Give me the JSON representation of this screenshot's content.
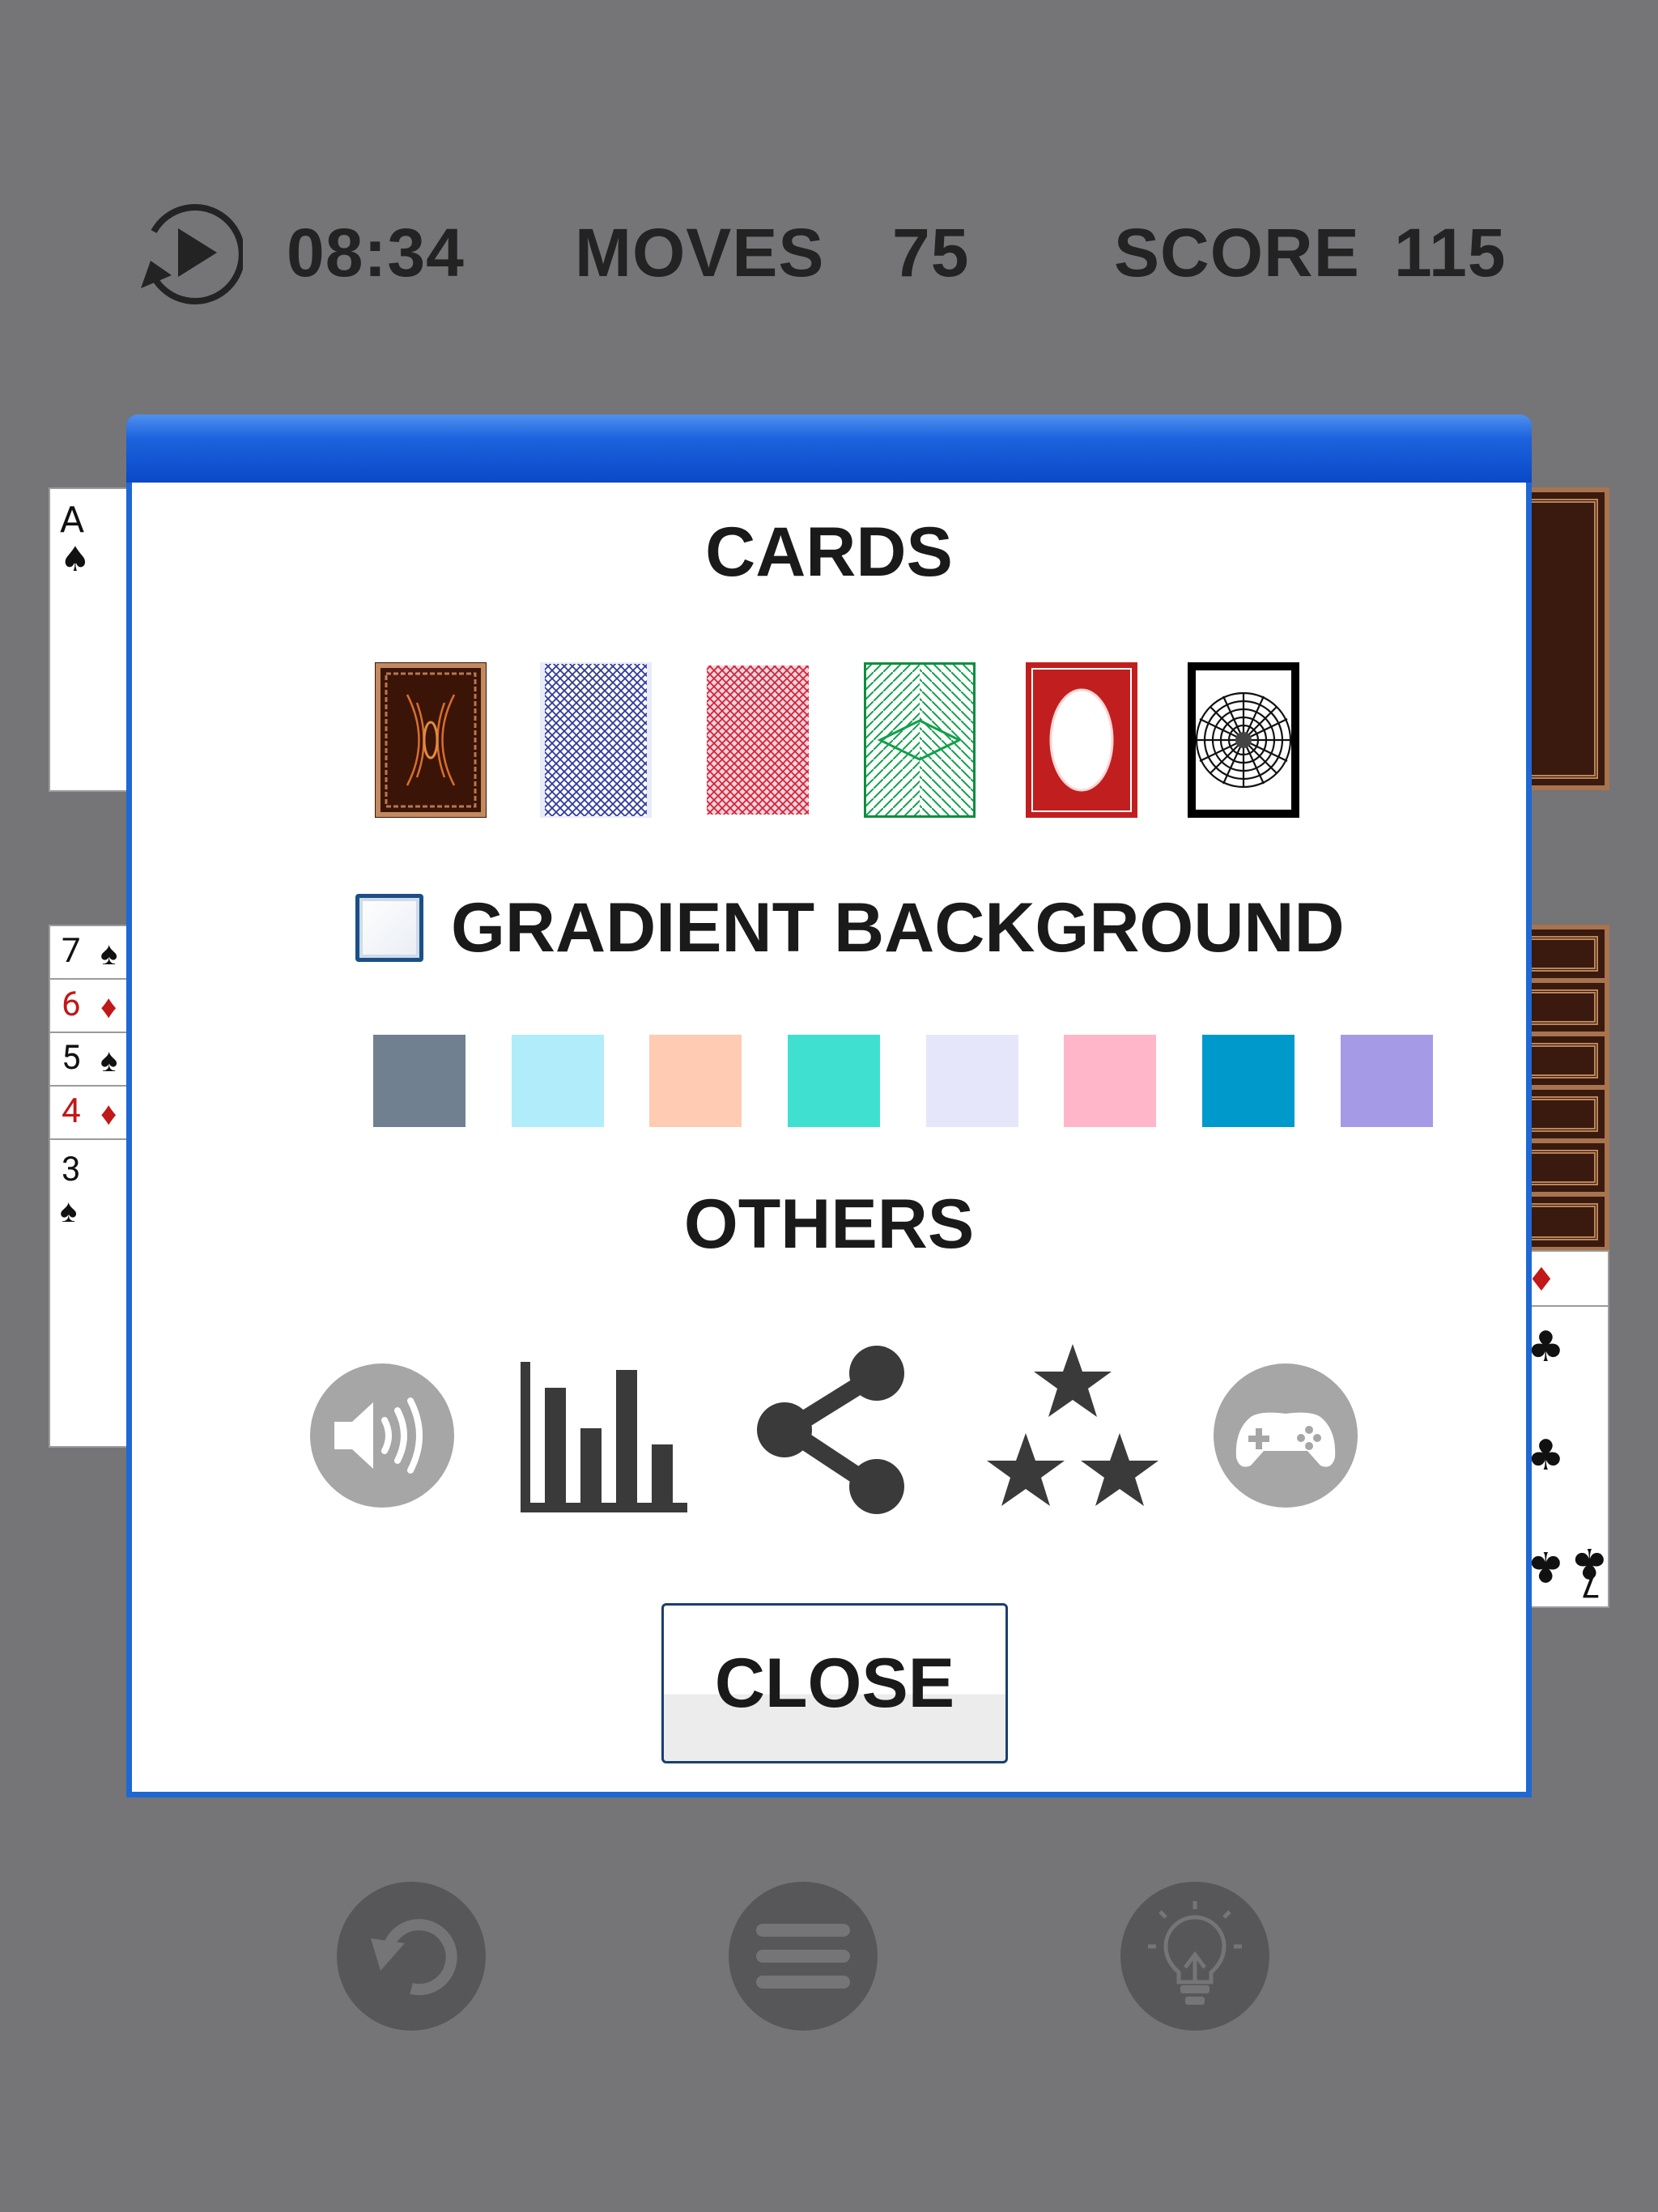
{
  "hud": {
    "timer": "08:34",
    "moves_label": "MOVES",
    "moves_value": "75",
    "score_label": "SCORE",
    "score_value": "115"
  },
  "background_cards": {
    "ace": {
      "rank": "A",
      "suit": "♠"
    },
    "tableau": [
      {
        "rank": "7",
        "suit": "♠",
        "color": "black"
      },
      {
        "rank": "6",
        "suit": "♦",
        "color": "red"
      },
      {
        "rank": "5",
        "suit": "♠",
        "color": "black"
      },
      {
        "rank": "4",
        "suit": "♦",
        "color": "red"
      },
      {
        "rank": "3",
        "suit": "♠",
        "color": "black"
      }
    ],
    "right_card": {
      "rank": "7",
      "suit": "♣"
    }
  },
  "dialog": {
    "cards_title": "CARDS",
    "card_backs": [
      "brown-ornate",
      "blue-diamond",
      "red-diamond",
      "green-chevron",
      "red-oval",
      "black-spiral"
    ],
    "gradient_checkbox_label": "GRADIENT BACKGROUND",
    "gradient_checked": false,
    "background_colors": [
      "#708090",
      "#b0ecf9",
      "#ffcbb2",
      "#40e0d0",
      "#e6e6fa",
      "#ffb6c8",
      "#0099cc",
      "#a59ae6"
    ],
    "others_title": "OTHERS",
    "others_icons": [
      "sound-icon",
      "statistics-icon",
      "share-icon",
      "rate-stars-icon",
      "game-controller-icon"
    ],
    "close_label": "CLOSE"
  },
  "bottom_controls": [
    "undo-icon",
    "menu-icon",
    "hint-lightbulb-icon"
  ],
  "colors": {
    "backdrop": "#757477",
    "dialog_border": "#1e68d4",
    "icon_gray": "#383838",
    "button_gray": "#575659"
  }
}
